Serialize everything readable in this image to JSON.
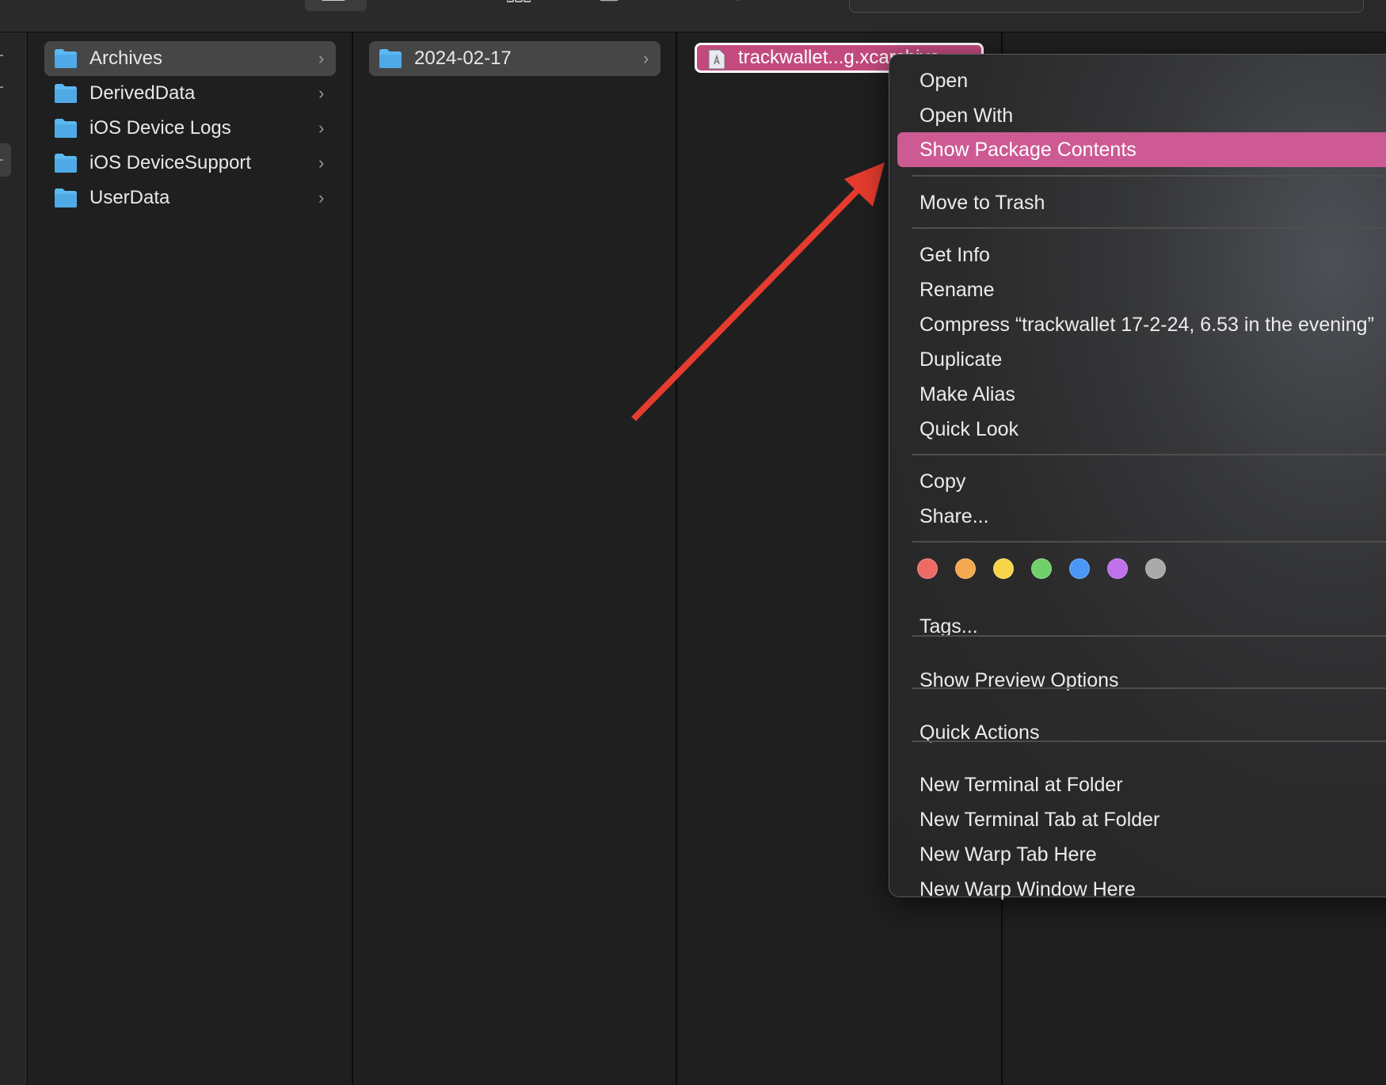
{
  "sidebar_column": {
    "items": [
      {
        "label": "Archives"
      },
      {
        "label": "DerivedData"
      },
      {
        "label": "iOS Device Logs"
      },
      {
        "label": "iOS DeviceSupport"
      },
      {
        "label": "UserData"
      }
    ]
  },
  "date_column": {
    "items": [
      {
        "label": "2024-02-17"
      }
    ]
  },
  "selected_file": {
    "label": "trackwallet...g.xcarchive"
  },
  "context_menu": {
    "open": "Open",
    "open_with": "Open With",
    "show_package_contents": "Show Package Contents",
    "move_to_trash": "Move to Trash",
    "get_info": "Get Info",
    "rename": "Rename",
    "compress": "Compress “trackwallet 17-2-24, 6.53 in the evening”",
    "duplicate": "Duplicate",
    "make_alias": "Make Alias",
    "quick_look": "Quick Look",
    "copy": "Copy",
    "share": "Share...",
    "tags": "Tags...",
    "show_preview_options": "Show Preview Options",
    "quick_actions": "Quick Actions",
    "new_terminal_at_folder": "New Terminal at Folder",
    "new_terminal_tab_at_folder": "New Terminal Tab at Folder",
    "new_warp_tab_here": "New Warp Tab Here",
    "new_warp_window_here": "New Warp Window Here",
    "tag_colors": [
      {
        "name": "red",
        "color": "#ee6a65"
      },
      {
        "name": "orange",
        "color": "#f5a94f"
      },
      {
        "name": "yellow",
        "color": "#f7d54b"
      },
      {
        "name": "green",
        "color": "#6fd169"
      },
      {
        "name": "blue",
        "color": "#4a97f5"
      },
      {
        "name": "purple",
        "color": "#c170ec"
      },
      {
        "name": "gray",
        "color": "#a9a9a9"
      }
    ]
  },
  "colors": {
    "highlight": "#cd5a93",
    "selection_pink": "#c24a7e",
    "arrow": "#e63c2f",
    "folder_blue": "#5bb8f0"
  }
}
